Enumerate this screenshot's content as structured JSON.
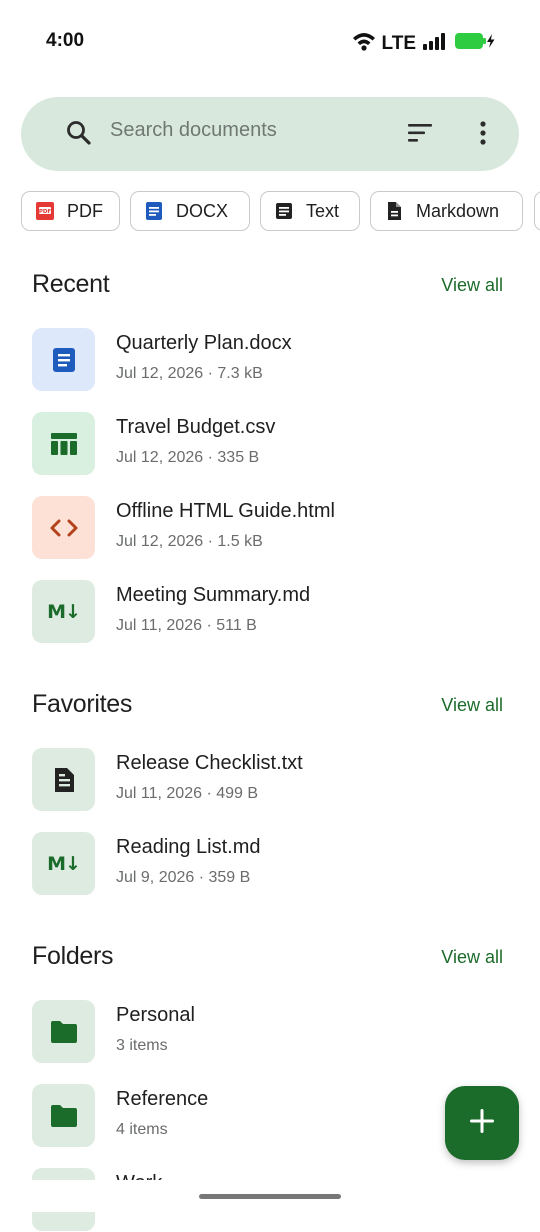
{
  "status_bar": {
    "time": "4:00",
    "network": "LTE"
  },
  "search": {
    "placeholder": "Search documents"
  },
  "chips": [
    {
      "label": "PDF",
      "icon": "pdf-icon",
      "color": "#e53935"
    },
    {
      "label": "DOCX",
      "icon": "docx-icon",
      "color": "#1e5bbd"
    },
    {
      "label": "Text",
      "icon": "text-icon",
      "color": "#222222"
    },
    {
      "label": "Markdown",
      "icon": "markdown-file-icon",
      "color": "#222222"
    }
  ],
  "recent": {
    "title": "Recent",
    "view_all": "View all",
    "items": [
      {
        "name": "Quarterly Plan.docx",
        "meta": "Jul 12, 2026 · 7.3 kB",
        "icon": "docx-icon",
        "bg": "#dde8fb"
      },
      {
        "name": "Travel Budget.csv",
        "meta": "Jul 12, 2026 · 335 B",
        "icon": "table-icon",
        "bg": "#d9efdf"
      },
      {
        "name": "Offline HTML Guide.html",
        "meta": "Jul 12, 2026 · 1.5 kB",
        "icon": "code-icon",
        "bg": "#fde1d7"
      },
      {
        "name": "Meeting Summary.md",
        "meta": "Jul 11, 2026 · 511 B",
        "icon": "markdown-icon",
        "bg": "#deebe1"
      }
    ]
  },
  "favorites": {
    "title": "Favorites",
    "view_all": "View all",
    "items": [
      {
        "name": "Release Checklist.txt",
        "meta": "Jul 11, 2026 · 499 B",
        "icon": "text-icon",
        "bg": "#deebe1"
      },
      {
        "name": "Reading List.md",
        "meta": "Jul 9, 2026 · 359 B",
        "icon": "markdown-icon",
        "bg": "#deebe1"
      }
    ]
  },
  "folders": {
    "title": "Folders",
    "view_all": "View all",
    "items": [
      {
        "name": "Personal",
        "meta": "3 items",
        "icon": "folder-icon",
        "bg": "#deebe1"
      },
      {
        "name": "Reference",
        "meta": "4 items",
        "icon": "folder-icon",
        "bg": "#deebe1"
      },
      {
        "name": "Work",
        "icon": "folder-icon",
        "bg": "#deebe1"
      }
    ]
  },
  "markdown_badge": "M↓",
  "fab": {
    "icon": "plus-icon"
  },
  "colors": {
    "accent": "#1b6b2b",
    "search_bg": "#d8e8dc"
  }
}
